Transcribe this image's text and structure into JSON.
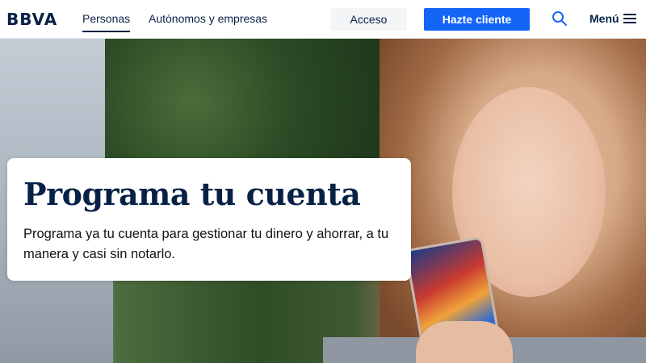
{
  "header": {
    "logo": "BBVA",
    "nav": [
      {
        "label": "Personas"
      },
      {
        "label": "Autónomos y empresas"
      }
    ],
    "acceso_label": "Acceso",
    "hazte_label": "Hazte cliente",
    "search_icon": "search-icon",
    "menu_label": "Menú",
    "menu_icon": "hamburger-icon"
  },
  "hero": {
    "title": "Programa tu cuenta",
    "description": "Programa ya tu cuenta para gestionar tu dinero y ahorrar, a tu manera y casi sin notarlo."
  },
  "colors": {
    "brand_navy": "#072146",
    "primary_blue": "#1464f6",
    "secondary_button_bg": "#f4f5f7"
  }
}
